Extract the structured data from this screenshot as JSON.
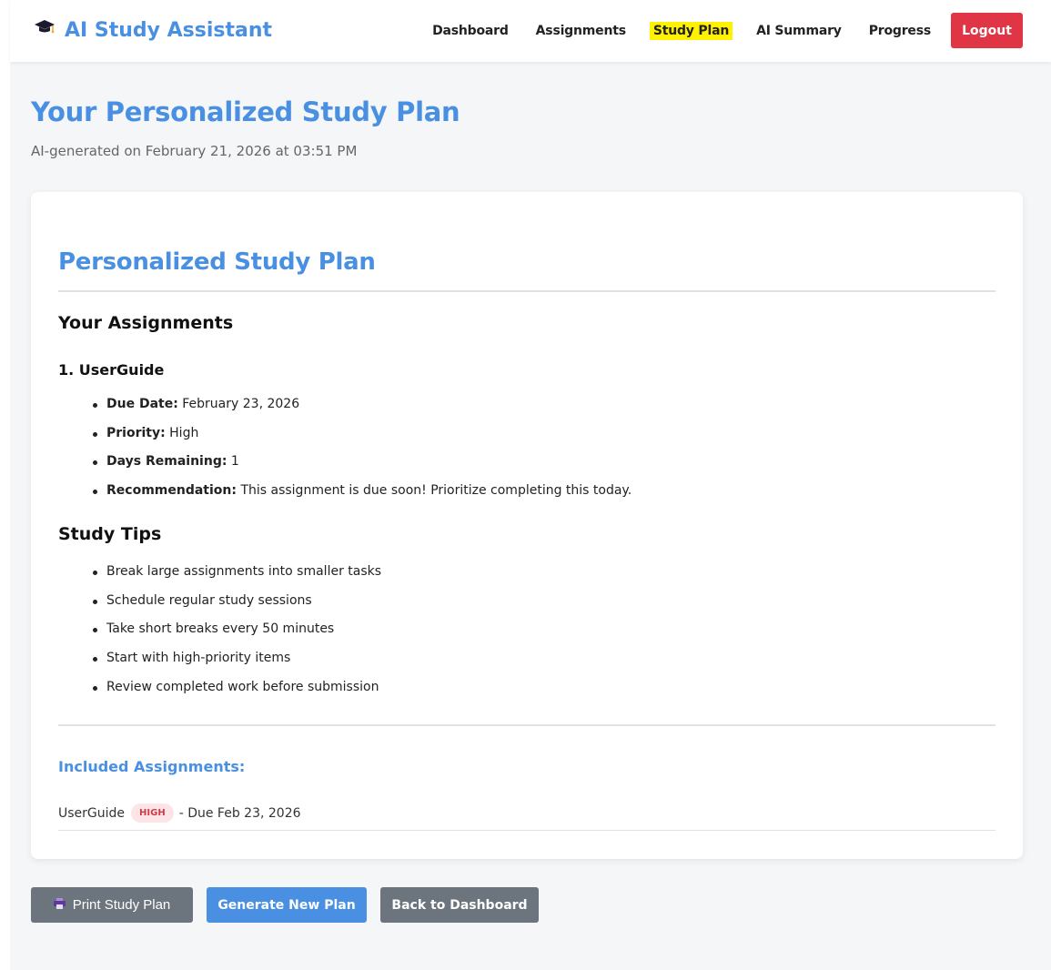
{
  "nav": {
    "brand": "AI Study Assistant",
    "links": [
      "Dashboard",
      "Assignments",
      "Study Plan",
      "AI Summary",
      "Progress"
    ],
    "active": "Study Plan",
    "logout": "Logout",
    "brand_icon": "graduation-cap-icon"
  },
  "header": {
    "title": "Your Personalized Study Plan",
    "subtitle": "AI-generated on February 21, 2026 at 03:51 PM"
  },
  "plan": {
    "title": "Personalized Study Plan",
    "assignments_heading": "Your Assignments",
    "item_heading": "1. UserGuide",
    "details": [
      {
        "label": "Due Date:",
        "value": "February 23, 2026"
      },
      {
        "label": "Priority:",
        "value": "High"
      },
      {
        "label": "Days Remaining:",
        "value": "1"
      },
      {
        "label": "Recommendation:",
        "value": "This assignment is due soon! Prioritize completing this today."
      }
    ],
    "tips_heading": "Study Tips",
    "tips": [
      "Break large assignments into smaller tasks",
      "Schedule regular study sessions",
      "Take short breaks every 50 minutes",
      "Start with high-priority items",
      "Review completed work before submission"
    ],
    "included_heading": "Included Assignments:",
    "included": {
      "name": "UserGuide",
      "priority": "HIGH",
      "due": "- Due Feb 23, 2026"
    }
  },
  "actions": {
    "print": "Print Study Plan",
    "generate": "Generate New Plan",
    "back": "Back to Dashboard",
    "print_icon": "printer-icon"
  },
  "colors": {
    "accent": "#4a90e2",
    "danger": "#e03545",
    "secondary": "#6c757d",
    "highlight": "#fff200"
  }
}
